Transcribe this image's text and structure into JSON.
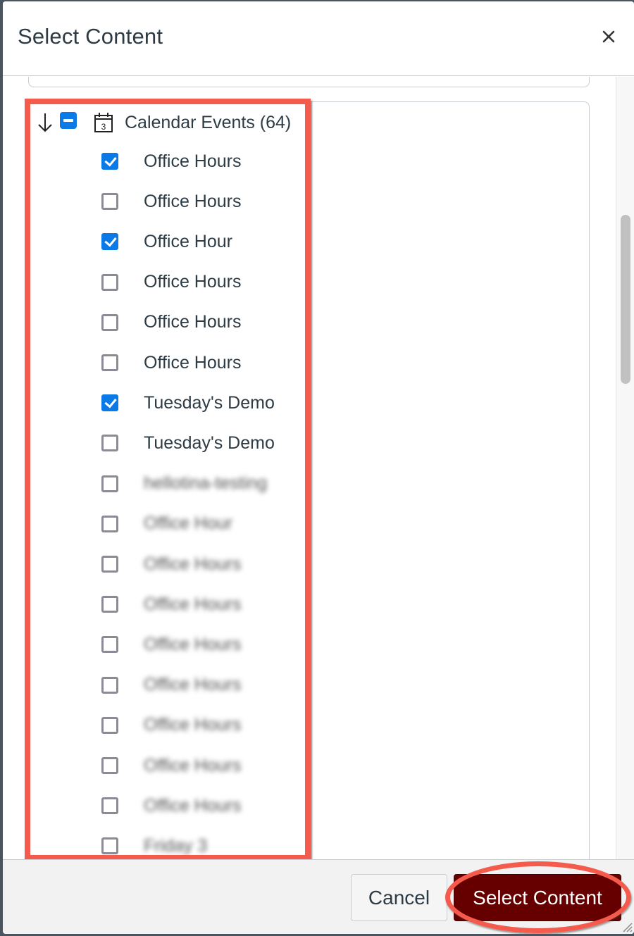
{
  "dialog": {
    "title": "Select Content",
    "close_label": "×"
  },
  "tree": {
    "parent": {
      "label": "Calendar Events (64)",
      "state": "indeterminate",
      "expanded": true,
      "icon": "calendar-icon",
      "icon_day": "3"
    },
    "items": [
      {
        "label": "Office Hours",
        "checked": true,
        "blurred": false
      },
      {
        "label": "Office Hours",
        "checked": false,
        "blurred": false
      },
      {
        "label": "Office Hour",
        "checked": true,
        "blurred": false
      },
      {
        "label": "Office Hours",
        "checked": false,
        "blurred": false
      },
      {
        "label": "Office Hours",
        "checked": false,
        "blurred": false
      },
      {
        "label": "Office Hours",
        "checked": false,
        "blurred": false
      },
      {
        "label": "Tuesday's Demo",
        "checked": true,
        "blurred": false
      },
      {
        "label": "Tuesday's Demo",
        "checked": false,
        "blurred": false
      },
      {
        "label": "hellotina-testing",
        "checked": false,
        "blurred": true
      },
      {
        "label": "Office Hour",
        "checked": false,
        "blurred": true
      },
      {
        "label": "Office Hours",
        "checked": false,
        "blurred": true
      },
      {
        "label": "Office Hours",
        "checked": false,
        "blurred": true
      },
      {
        "label": "Office Hours",
        "checked": false,
        "blurred": true
      },
      {
        "label": "Office Hours",
        "checked": false,
        "blurred": true
      },
      {
        "label": "Office Hours",
        "checked": false,
        "blurred": true
      },
      {
        "label": "Office Hours",
        "checked": false,
        "blurred": true
      },
      {
        "label": "Office Hours",
        "checked": false,
        "blurred": true
      },
      {
        "label": "Friday 3",
        "checked": false,
        "blurred": true
      }
    ]
  },
  "footer": {
    "cancel_label": "Cancel",
    "select_label": "Select Content"
  },
  "colors": {
    "accent_blue": "#0b7ae6",
    "primary_button": "#660000",
    "annotation_red": "#f45b4d"
  }
}
